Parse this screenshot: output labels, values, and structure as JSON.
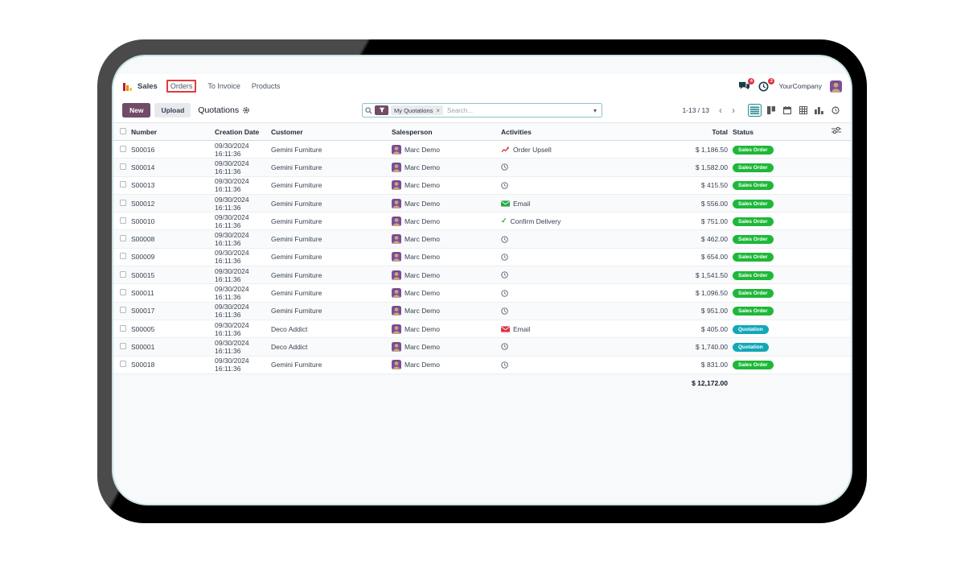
{
  "nav": {
    "app_name": "Sales",
    "items": [
      {
        "label": "Orders",
        "annotated": true
      },
      {
        "label": "To Invoice",
        "annotated": false
      },
      {
        "label": "Products",
        "annotated": false
      }
    ],
    "messages_badge": "4",
    "activities_badge": "2",
    "company": "YourCompany"
  },
  "toolbar": {
    "new_label": "New",
    "upload_label": "Upload",
    "title": "Quotations",
    "search": {
      "facet": "My Quotations",
      "placeholder": "Search..."
    },
    "pager": "1-13 / 13",
    "views": [
      "list",
      "kanban",
      "calendar",
      "pivot",
      "graph",
      "activity"
    ],
    "selected_view": "list"
  },
  "table": {
    "headers": [
      "Number",
      "Creation Date",
      "Customer",
      "Salesperson",
      "Activities",
      "Total",
      "Status"
    ],
    "rows": [
      {
        "number": "S00016",
        "date": "09/30/2024 16:11:36",
        "customer": "Gemini Furniture",
        "salesperson": "Marc Demo",
        "activity": {
          "type": "upsell",
          "label": "Order Upsell"
        },
        "total": "$ 1,186.50",
        "status": "Sales Order",
        "status_type": "sales_order"
      },
      {
        "number": "S00014",
        "date": "09/30/2024 16:11:36",
        "customer": "Gemini Furniture",
        "salesperson": "Marc Demo",
        "activity": {
          "type": "clock",
          "label": ""
        },
        "total": "$ 1,582.00",
        "status": "Sales Order",
        "status_type": "sales_order"
      },
      {
        "number": "S00013",
        "date": "09/30/2024 16:11:36",
        "customer": "Gemini Furniture",
        "salesperson": "Marc Demo",
        "activity": {
          "type": "clock",
          "label": ""
        },
        "total": "$ 415.50",
        "status": "Sales Order",
        "status_type": "sales_order"
      },
      {
        "number": "S00012",
        "date": "09/30/2024 16:11:36",
        "customer": "Gemini Furniture",
        "salesperson": "Marc Demo",
        "activity": {
          "type": "email_green",
          "label": "Email"
        },
        "total": "$ 556.00",
        "status": "Sales Order",
        "status_type": "sales_order"
      },
      {
        "number": "S00010",
        "date": "09/30/2024 16:11:36",
        "customer": "Gemini Furniture",
        "salesperson": "Marc Demo",
        "activity": {
          "type": "check",
          "label": "Confirm Delivery"
        },
        "total": "$ 751.00",
        "status": "Sales Order",
        "status_type": "sales_order"
      },
      {
        "number": "S00008",
        "date": "09/30/2024 16:11:36",
        "customer": "Gemini Furniture",
        "salesperson": "Marc Demo",
        "activity": {
          "type": "clock",
          "label": ""
        },
        "total": "$ 462.00",
        "status": "Sales Order",
        "status_type": "sales_order"
      },
      {
        "number": "S00009",
        "date": "09/30/2024 16:11:36",
        "customer": "Gemini Furniture",
        "salesperson": "Marc Demo",
        "activity": {
          "type": "clock",
          "label": ""
        },
        "total": "$ 654.00",
        "status": "Sales Order",
        "status_type": "sales_order"
      },
      {
        "number": "S00015",
        "date": "09/30/2024 16:11:36",
        "customer": "Gemini Furniture",
        "salesperson": "Marc Demo",
        "activity": {
          "type": "clock",
          "label": ""
        },
        "total": "$ 1,541.50",
        "status": "Sales Order",
        "status_type": "sales_order"
      },
      {
        "number": "S00011",
        "date": "09/30/2024 16:11:36",
        "customer": "Gemini Furniture",
        "salesperson": "Marc Demo",
        "activity": {
          "type": "clock",
          "label": ""
        },
        "total": "$ 1,096.50",
        "status": "Sales Order",
        "status_type": "sales_order"
      },
      {
        "number": "S00017",
        "date": "09/30/2024 16:11:36",
        "customer": "Gemini Furniture",
        "salesperson": "Marc Demo",
        "activity": {
          "type": "clock",
          "label": ""
        },
        "total": "$ 951.00",
        "status": "Sales Order",
        "status_type": "sales_order"
      },
      {
        "number": "S00005",
        "date": "09/30/2024 16:11:36",
        "customer": "Deco Addict",
        "salesperson": "Marc Demo",
        "activity": {
          "type": "email_red",
          "label": "Email"
        },
        "total": "$ 405.00",
        "status": "Quotation",
        "status_type": "quotation"
      },
      {
        "number": "S00001",
        "date": "09/30/2024 16:11:36",
        "customer": "Deco Addict",
        "salesperson": "Marc Demo",
        "activity": {
          "type": "clock",
          "label": ""
        },
        "total": "$ 1,740.00",
        "status": "Quotation",
        "status_type": "quotation"
      },
      {
        "number": "S00018",
        "date": "09/30/2024 16:11:36",
        "customer": "Gemini Furniture",
        "salesperson": "Marc Demo",
        "activity": {
          "type": "clock",
          "label": ""
        },
        "total": "$ 831.00",
        "status": "Sales Order",
        "status_type": "sales_order"
      }
    ],
    "footer_total": "$ 12,172.00"
  },
  "colors": {
    "accent_purple": "#714b67",
    "badge_sales_order": "#1eb839",
    "badge_quotation": "#12a8b8",
    "annotation_red": "#e6393d",
    "view_selected_teal": "#2c8d93",
    "danger_red": "#dc3545",
    "success_green": "#28a745"
  }
}
